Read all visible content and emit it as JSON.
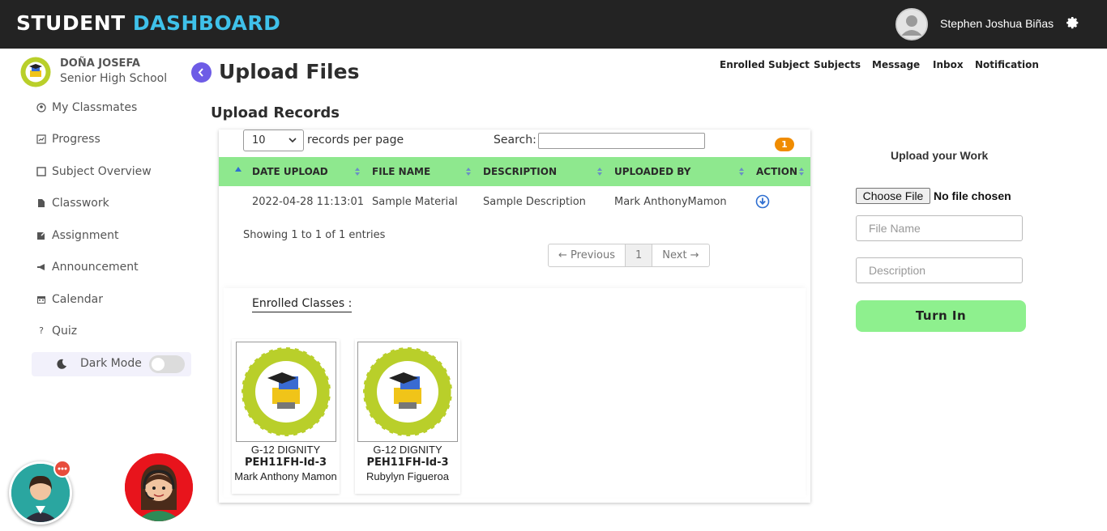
{
  "header": {
    "brand_part1": "STUDENT",
    "brand_part2": "DASHBOARD",
    "user_name": "Stephen Joshua Biñas",
    "colors": {
      "bar": "#232323",
      "brand_accent": "#3fc1ea"
    }
  },
  "sidebar": {
    "school_line1": "DOÑA JOSEFA",
    "school_line2": "Senior High School",
    "items": [
      {
        "label": "My Classmates",
        "icon": "user-circle-icon"
      },
      {
        "label": "Progress",
        "icon": "chart-icon"
      },
      {
        "label": "Subject Overview",
        "icon": "square-icon"
      },
      {
        "label": "Classwork",
        "icon": "document-icon"
      },
      {
        "label": "Assignment",
        "icon": "edit-icon"
      },
      {
        "label": "Announcement",
        "icon": "megaphone-icon"
      },
      {
        "label": "Calendar",
        "icon": "calendar-icon"
      },
      {
        "label": "Quiz",
        "icon": "question-icon"
      }
    ],
    "dark_mode_label": "Dark Mode"
  },
  "page": {
    "title": "Upload Files",
    "nav": [
      "Enrolled Subject",
      "Subjects",
      "Message",
      "Inbox",
      "Notification"
    ],
    "section_title": "Upload Records"
  },
  "table": {
    "per_page_value": "10",
    "per_page_label": "records per page",
    "search_label": "Search:",
    "badge": "1",
    "columns": [
      "DATE UPLOAD",
      "FILE NAME",
      "DESCRIPTION",
      "UPLOADED BY",
      "ACTION"
    ],
    "rows": [
      {
        "date": "2022-04-28 11:13:01",
        "file": "Sample Material",
        "description": "Sample Description",
        "uploaded_by": "Mark AnthonyMamon"
      }
    ],
    "showing": "Showing 1 to 1 of 1 entries",
    "pager": {
      "prev": "← Previous",
      "page": "1",
      "next": "Next →"
    },
    "header_color": "#8ee88e"
  },
  "enrolled": {
    "title": "Enrolled Classes :",
    "classes": [
      {
        "section": "G-12 DIGNITY",
        "code": "PEH11FH-Id-3",
        "teacher": "Mark Anthony Mamon"
      },
      {
        "section": "G-12 DIGNITY",
        "code": "PEH11FH-Id-3",
        "teacher": "Rubylyn Figueroa"
      }
    ]
  },
  "upload_form": {
    "title": "Upload your Work",
    "choose_label": "Choose File",
    "no_file": "No file chosen",
    "file_name_placeholder": "File Name",
    "description_placeholder": "Description",
    "submit_label": "Turn In",
    "submit_color": "#8ef08e"
  }
}
